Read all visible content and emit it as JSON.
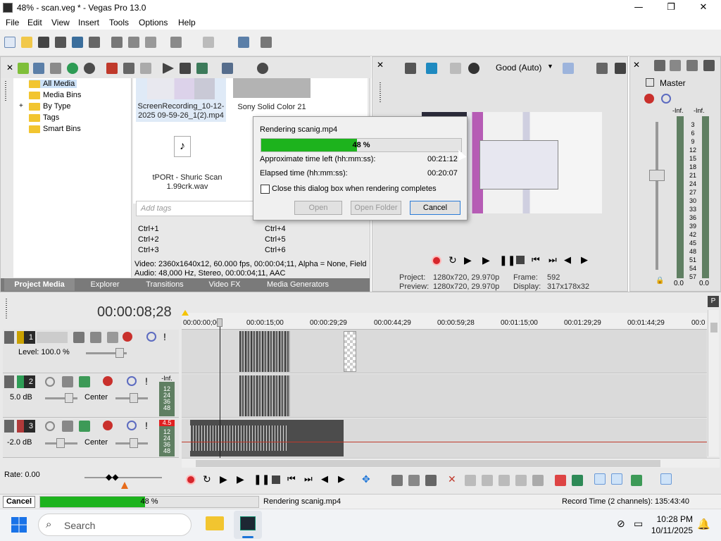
{
  "window": {
    "title": "48% - scan.veg * - Vegas Pro 13.0",
    "minimize": "—",
    "maximize": "❐",
    "close": "✕"
  },
  "menu": [
    "File",
    "Edit",
    "View",
    "Insert",
    "Tools",
    "Options",
    "Help"
  ],
  "project_media": {
    "tree": [
      "All Media",
      "Media Bins",
      "By Type",
      "Tags",
      "Smart Bins"
    ],
    "expander": "+",
    "media": [
      {
        "name": "ScreenRecording_10-12-2025 09-59-26_1(2).mp4"
      },
      {
        "name": "Sony Solid Color 21"
      },
      {
        "name": "tPORt - Shuric Scan 1.99crk.wav"
      }
    ],
    "tags_placeholder": "Add tags",
    "shortcuts_left": [
      "Ctrl+1",
      "Ctrl+2",
      "Ctrl+3"
    ],
    "shortcuts_right": [
      "Ctrl+4",
      "Ctrl+5",
      "Ctrl+6"
    ],
    "info_video": "Video: 2360x1640x12, 60.000 fps, 00:00:04;11, Alpha = None, Field",
    "info_audio": "Audio: 48,000 Hz, Stereo, 00:00:04;11, AAC",
    "tabs": [
      "Project Media",
      "Explorer",
      "Transitions",
      "Video FX",
      "Media Generators"
    ]
  },
  "preview": {
    "quality": "Good (Auto)",
    "project_label": "Project:",
    "project_value": "1280x720, 29.970p",
    "preview_label": "Preview:",
    "preview_value": "1280x720, 29.970p",
    "frame_label": "Frame:",
    "frame_value": "592",
    "display_label": "Display:",
    "display_value": "317x178x32"
  },
  "master": {
    "title": "Master",
    "inf_left": "-Inf.",
    "inf_right": "-Inf.",
    "scale": [
      "3",
      "6",
      "9",
      "12",
      "15",
      "18",
      "21",
      "24",
      "27",
      "30",
      "33",
      "36",
      "39",
      "42",
      "45",
      "48",
      "51",
      "54",
      "57"
    ],
    "bottom_left": "0.0",
    "bottom_right": "0.0"
  },
  "render_dialog": {
    "title": "Rendering scanig.mp4",
    "progress_percent": 48,
    "progress_text": "48 %",
    "time_left_label": "Approximate time left (hh:mm:ss):",
    "time_left_value": "00:21:12",
    "elapsed_label": "Elapsed time (hh:mm:ss):",
    "elapsed_value": "00:20:07",
    "close_checkbox": "Close this dialog box when rendering completes",
    "close_checked": false,
    "open_button": "Open",
    "open_folder_button": "Open Folder",
    "cancel_button": "Cancel"
  },
  "timeline": {
    "timecode": "00:00:08;28",
    "ruler": [
      "00:00:00;00",
      "00:00:15;00",
      "00:00:29;29",
      "00:00:44;29",
      "00:00:59;28",
      "00:01:15;00",
      "00:01:29;29",
      "00:01:44;29",
      "00:0"
    ],
    "tracks": [
      {
        "number": "1",
        "level": "Level: 100.0 %"
      },
      {
        "number": "2",
        "vol": "5.0 dB",
        "pan": "Center",
        "meter_top": "-Inf.",
        "meter_scale": [
          "12",
          "24",
          "36",
          "48"
        ]
      },
      {
        "number": "3",
        "vol": "-2.0 dB",
        "pan": "Center",
        "meter_top": "4.5",
        "meter_scale": [
          "12",
          "24",
          "36",
          "48"
        ]
      }
    ],
    "rate": "Rate: 0.00"
  },
  "statusbar": {
    "cancel": "Cancel",
    "progress_percent": 48,
    "progress_text": "48 %",
    "message": "Rendering scanig.mp4",
    "record_time": "Record Time (2 channels): 135:43:40"
  },
  "taskbar": {
    "search_placeholder": "Search",
    "time": "10:28 PM",
    "date": "10/11/2025"
  },
  "colors": {
    "progress": "#1db31d",
    "accent": "#1b74d8",
    "panel": "#e8e8e8",
    "tab_bar": "#7a7a7a"
  }
}
